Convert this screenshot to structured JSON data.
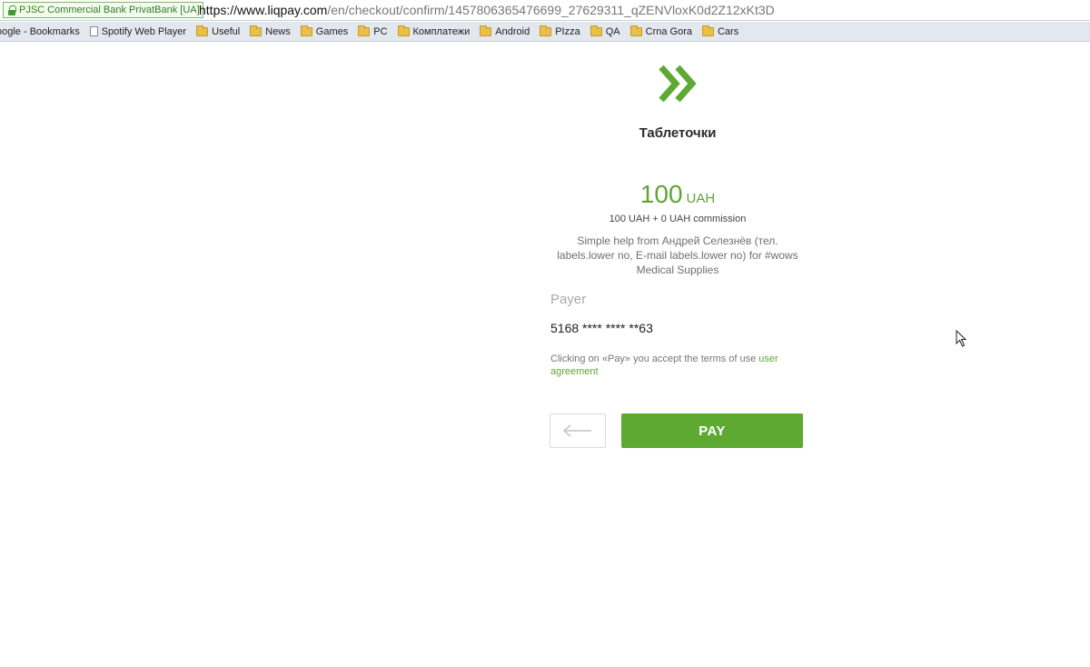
{
  "browser": {
    "cert_name": "PJSC Commercial Bank PrivatBank [UA]",
    "url_host": "https://www.liqpay.com",
    "url_path": "/en/checkout/confirm/1457806365476699_27629311_qZENVloxK0d2Z12xKt3D"
  },
  "bookmarks": [
    {
      "label": "oogle - Bookmarks",
      "icon": "none"
    },
    {
      "label": "Spotify Web Player",
      "icon": "page-icon"
    },
    {
      "label": "Useful",
      "icon": "folder-icon"
    },
    {
      "label": "News",
      "icon": "folder-icon"
    },
    {
      "label": "Games",
      "icon": "folder-icon"
    },
    {
      "label": "PC",
      "icon": "folder-icon"
    },
    {
      "label": "Комплатежи",
      "icon": "folder-icon"
    },
    {
      "label": "Android",
      "icon": "folder-icon"
    },
    {
      "label": "PIzza",
      "icon": "folder-icon"
    },
    {
      "label": "QA",
      "icon": "folder-icon"
    },
    {
      "label": "Crna Gora",
      "icon": "folder-icon"
    },
    {
      "label": "Cars",
      "icon": "folder-icon"
    }
  ],
  "checkout": {
    "merchant": "Таблеточки",
    "amount": "100",
    "currency": "UAH",
    "commission": "100 UAH + 0 UAH commission",
    "description": "Simple help from Андрей Селезнёв (тел. labels.lower no, E-mail labels.lower no) for #wows Medical Supplies",
    "payer_label": "Payer",
    "card_number": "5168 **** **** **63",
    "terms_text": "Clicking on «Pay» you accept the terms of use",
    "terms_link": "user agreement",
    "pay_label": "PAY"
  },
  "colors": {
    "brand_green": "#5ea932",
    "bookmarks_bar": "#e3e7ee"
  }
}
